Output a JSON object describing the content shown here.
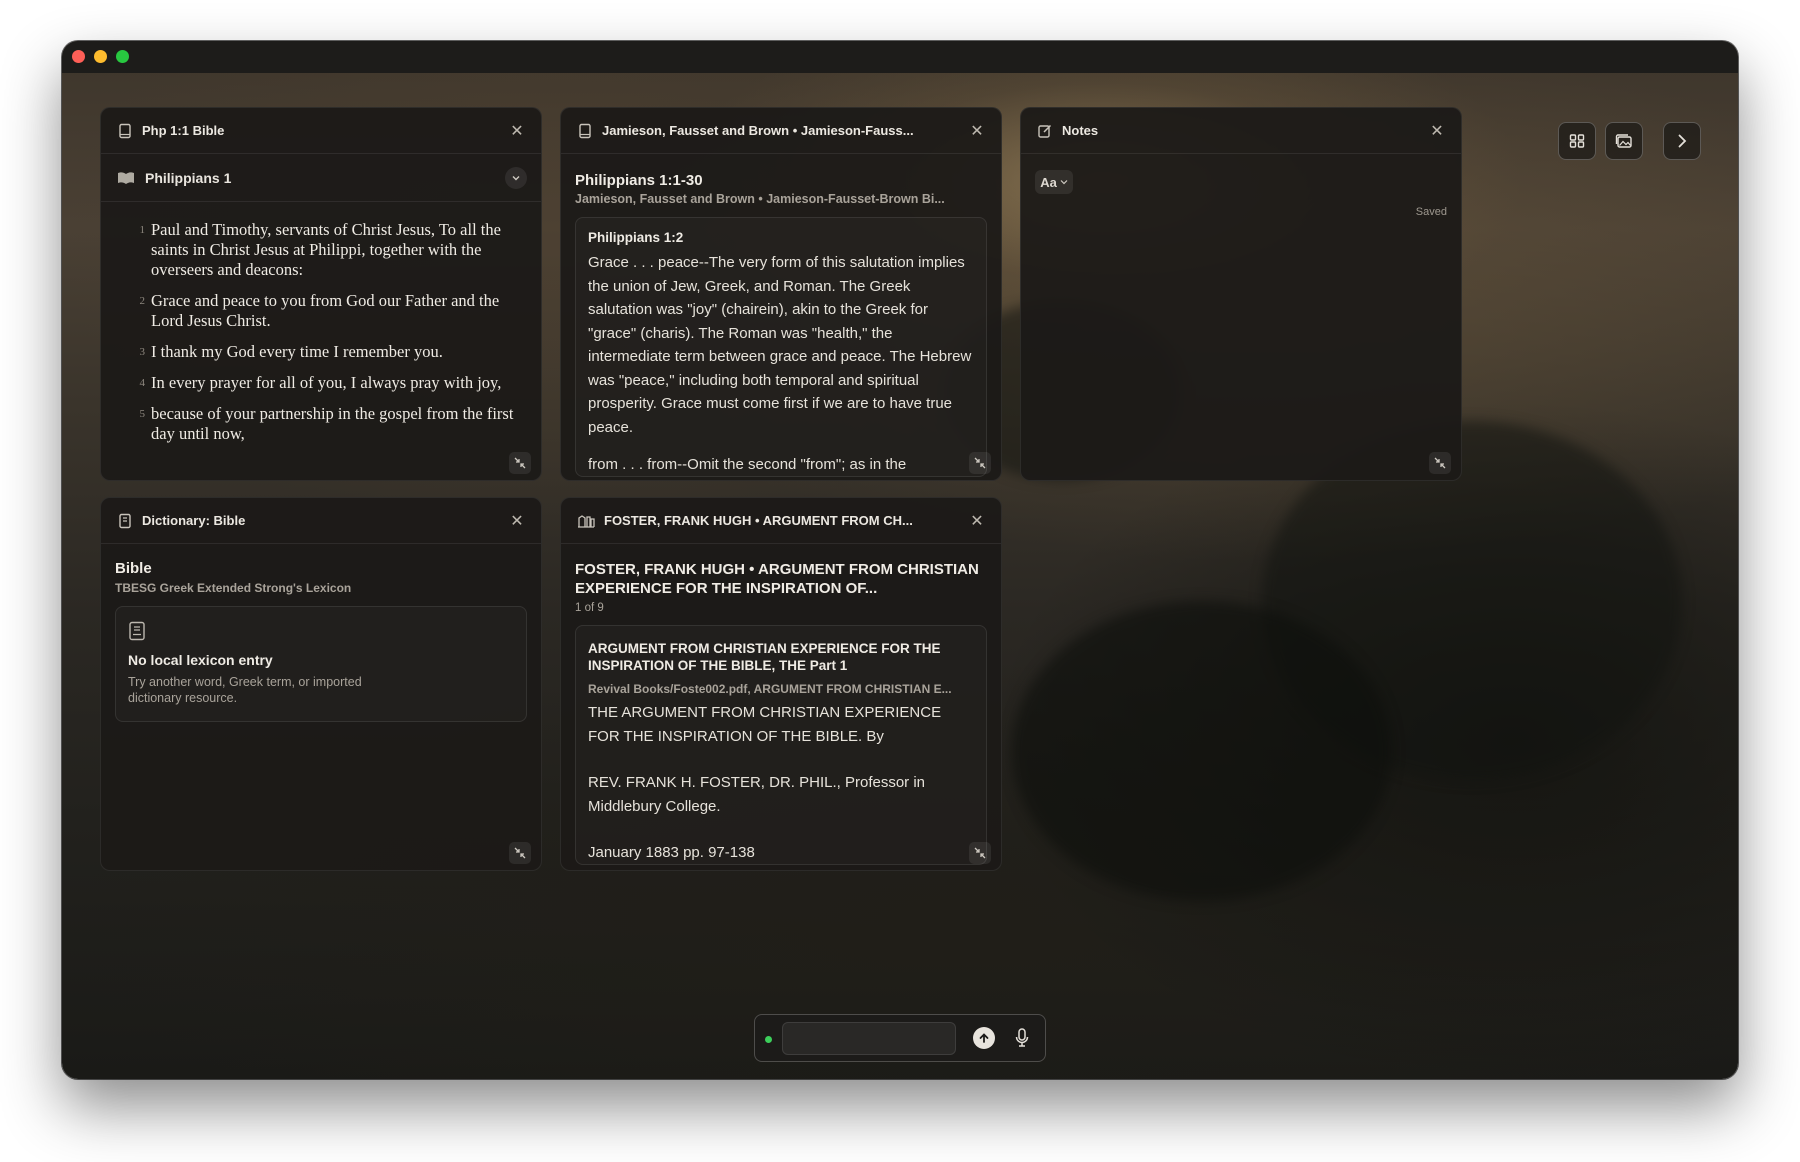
{
  "toolbar": {
    "grid_icon": "grid-icon",
    "gallery_icon": "image-stack-icon",
    "next_icon": "chevron-right-icon"
  },
  "bible": {
    "header": "Php 1:1 Bible",
    "book": "Philippians 1",
    "verses": [
      {
        "num": "1",
        "text": "Paul and Timothy, servants of Christ Jesus, To all the saints in Christ Jesus at Philippi, together with the overseers and deacons:"
      },
      {
        "num": "2",
        "text": "Grace and peace to you from God our Father and the Lord Jesus Christ."
      },
      {
        "num": "3",
        "text": "I thank my God every time I remember you."
      },
      {
        "num": "4",
        "text": "In every prayer for all of you, I always pray with joy,"
      },
      {
        "num": "5",
        "text": "because of your partnership in the gospel from the first day until now,"
      }
    ]
  },
  "commentary": {
    "header": "Jamieson, Fausset and Brown • Jamieson-Fauss...",
    "title": "Philippians 1:1-30",
    "subtitle": "Jamieson, Fausset and Brown • Jamieson-Fausset-Brown Bi...",
    "card_ref": "Philippians 1:2",
    "card_body": "Grace . . . peace--The very form of this salutation implies the union of Jew, Greek, and Roman. The Greek salutation was \"joy\" (chairein), akin to the Greek for \"grace\" (charis). The Roman was \"health,\" the intermediate term between grace and peace. The Hebrew was \"peace,\" including both temporal and spiritual prosperity. Grace must come first if we are to have true peace.",
    "card_next": "from . . . from--Omit the second \"from\"; as in the"
  },
  "notes": {
    "header": "Notes",
    "font_button": "Aa",
    "status": "Saved"
  },
  "dictionary": {
    "header": "Dictionary: Bible",
    "title": "Bible",
    "subtitle": "TBESG Greek Extended Strong's Lexicon",
    "empty_title": "No local lexicon entry",
    "empty_text": "Try another word, Greek term, or imported dictionary resource."
  },
  "foster": {
    "header": "FOSTER, FRANK HUGH • ARGUMENT FROM CH...",
    "title": "FOSTER, FRANK HUGH • ARGUMENT FROM CHRISTIAN EXPERIENCE FOR THE INSPIRATION OF...",
    "count": "1 of 9",
    "card_title": "ARGUMENT FROM CHRISTIAN EXPERIENCE FOR THE INSPIRATION OF THE BIBLE, THE Part 1",
    "card_source": "Revival Books/Foste002.pdf, ARGUMENT FROM CHRISTIAN E...",
    "para1": "THE ARGUMENT FROM CHRISTIAN EXPERIENCE FOR THE INSPIRATION OF THE BIBLE. By",
    "para2": "REV. FRANK H. FOSTER, DR. PHIL., Professor in Middlebury College.",
    "para3": "January 1883 pp. 97-138"
  },
  "input": {
    "placeholder": "",
    "status_color": "#3ccf5b"
  }
}
